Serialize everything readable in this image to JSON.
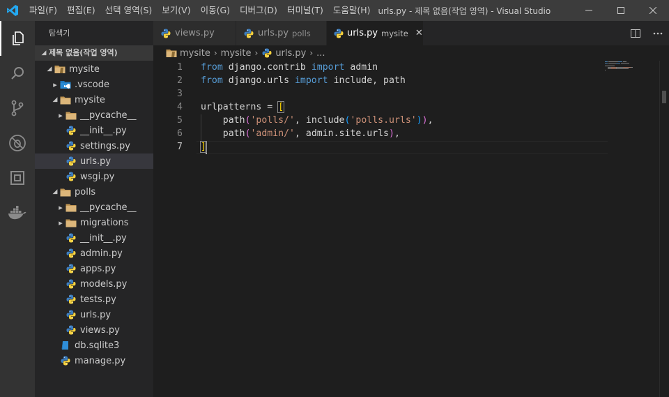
{
  "titlebar": {
    "menu": [
      "파일(F)",
      "편집(E)",
      "선택 영역(S)",
      "보기(V)",
      "이동(G)",
      "디버그(D)",
      "터미널(T)",
      "도움말(H)"
    ],
    "window_title": "urls.py - 제목 없음(작업 영역) - Visual Studio ..."
  },
  "activitybar": {
    "items": [
      "explorer-icon",
      "search-icon",
      "source-control-icon",
      "debug-icon",
      "extensions-icon",
      "docker-icon"
    ]
  },
  "sidebar": {
    "header": "탐색기",
    "section": "제목 없음(작업 영역)",
    "tree": [
      {
        "label": "mysite",
        "depth": 0,
        "kind": "root-folder",
        "expanded": true
      },
      {
        "label": ".vscode",
        "depth": 1,
        "kind": "vscode-folder",
        "expanded": false
      },
      {
        "label": "mysite",
        "depth": 1,
        "kind": "folder",
        "expanded": true
      },
      {
        "label": "__pycache__",
        "depth": 2,
        "kind": "folder",
        "expanded": false
      },
      {
        "label": "__init__.py",
        "depth": 2,
        "kind": "python"
      },
      {
        "label": "settings.py",
        "depth": 2,
        "kind": "python"
      },
      {
        "label": "urls.py",
        "depth": 2,
        "kind": "python",
        "selected": true
      },
      {
        "label": "wsgi.py",
        "depth": 2,
        "kind": "python"
      },
      {
        "label": "polls",
        "depth": 1,
        "kind": "folder",
        "expanded": true
      },
      {
        "label": "__pycache__",
        "depth": 2,
        "kind": "folder",
        "expanded": false
      },
      {
        "label": "migrations",
        "depth": 2,
        "kind": "folder",
        "expanded": false
      },
      {
        "label": "__init__.py",
        "depth": 2,
        "kind": "python"
      },
      {
        "label": "admin.py",
        "depth": 2,
        "kind": "python"
      },
      {
        "label": "apps.py",
        "depth": 2,
        "kind": "python"
      },
      {
        "label": "models.py",
        "depth": 2,
        "kind": "python"
      },
      {
        "label": "tests.py",
        "depth": 2,
        "kind": "python"
      },
      {
        "label": "urls.py",
        "depth": 2,
        "kind": "python"
      },
      {
        "label": "views.py",
        "depth": 2,
        "kind": "python"
      },
      {
        "label": "db.sqlite3",
        "depth": 1,
        "kind": "database"
      },
      {
        "label": "manage.py",
        "depth": 1,
        "kind": "python"
      }
    ]
  },
  "tabs": [
    {
      "label": "views.py",
      "sub": "",
      "active": false
    },
    {
      "label": "urls.py",
      "sub": "polls",
      "active": false
    },
    {
      "label": "urls.py",
      "sub": "mysite",
      "active": true
    }
  ],
  "breadcrumb": [
    "mysite",
    "mysite",
    "urls.py",
    "..."
  ],
  "editor": {
    "current_line": 7,
    "lines": [
      [
        {
          "t": "from",
          "c": "kw"
        },
        {
          "t": " django.contrib ",
          "c": "ident"
        },
        {
          "t": "import",
          "c": "kw"
        },
        {
          "t": " admin",
          "c": "ident"
        }
      ],
      [
        {
          "t": "from",
          "c": "kw"
        },
        {
          "t": " django.urls ",
          "c": "ident"
        },
        {
          "t": "import",
          "c": "kw"
        },
        {
          "t": " include, path",
          "c": "ident"
        }
      ],
      [],
      [
        {
          "t": "urlpatterns = ",
          "c": "ident"
        },
        {
          "t": "[",
          "c": "br1 br-match"
        }
      ],
      [
        {
          "t": "    path",
          "c": "ident"
        },
        {
          "t": "(",
          "c": "br2"
        },
        {
          "t": "'polls/'",
          "c": "str"
        },
        {
          "t": ", include",
          "c": "ident"
        },
        {
          "t": "(",
          "c": "br3"
        },
        {
          "t": "'polls.urls'",
          "c": "str"
        },
        {
          "t": ")",
          "c": "br3"
        },
        {
          "t": ")",
          "c": "br2"
        },
        {
          "t": ",",
          "c": "ident"
        }
      ],
      [
        {
          "t": "    path",
          "c": "ident"
        },
        {
          "t": "(",
          "c": "br2"
        },
        {
          "t": "'admin/'",
          "c": "str"
        },
        {
          "t": ", admin.site.urls",
          "c": "ident"
        },
        {
          "t": ")",
          "c": "br2"
        },
        {
          "t": ",",
          "c": "ident"
        }
      ],
      [
        {
          "t": "]",
          "c": "br1 br-match"
        }
      ]
    ]
  },
  "colors": {
    "titlebar_bg": "#3c3c3c",
    "activitybar_bg": "#333333",
    "sidebar_bg": "#252526",
    "editor_bg": "#1e1e1e",
    "keyword": "#569cd6",
    "string": "#ce9178",
    "python_blue": "#3572a5",
    "python_yellow": "#ffd43b",
    "folder": "#c09553",
    "vscode_accent": "#007acc"
  }
}
